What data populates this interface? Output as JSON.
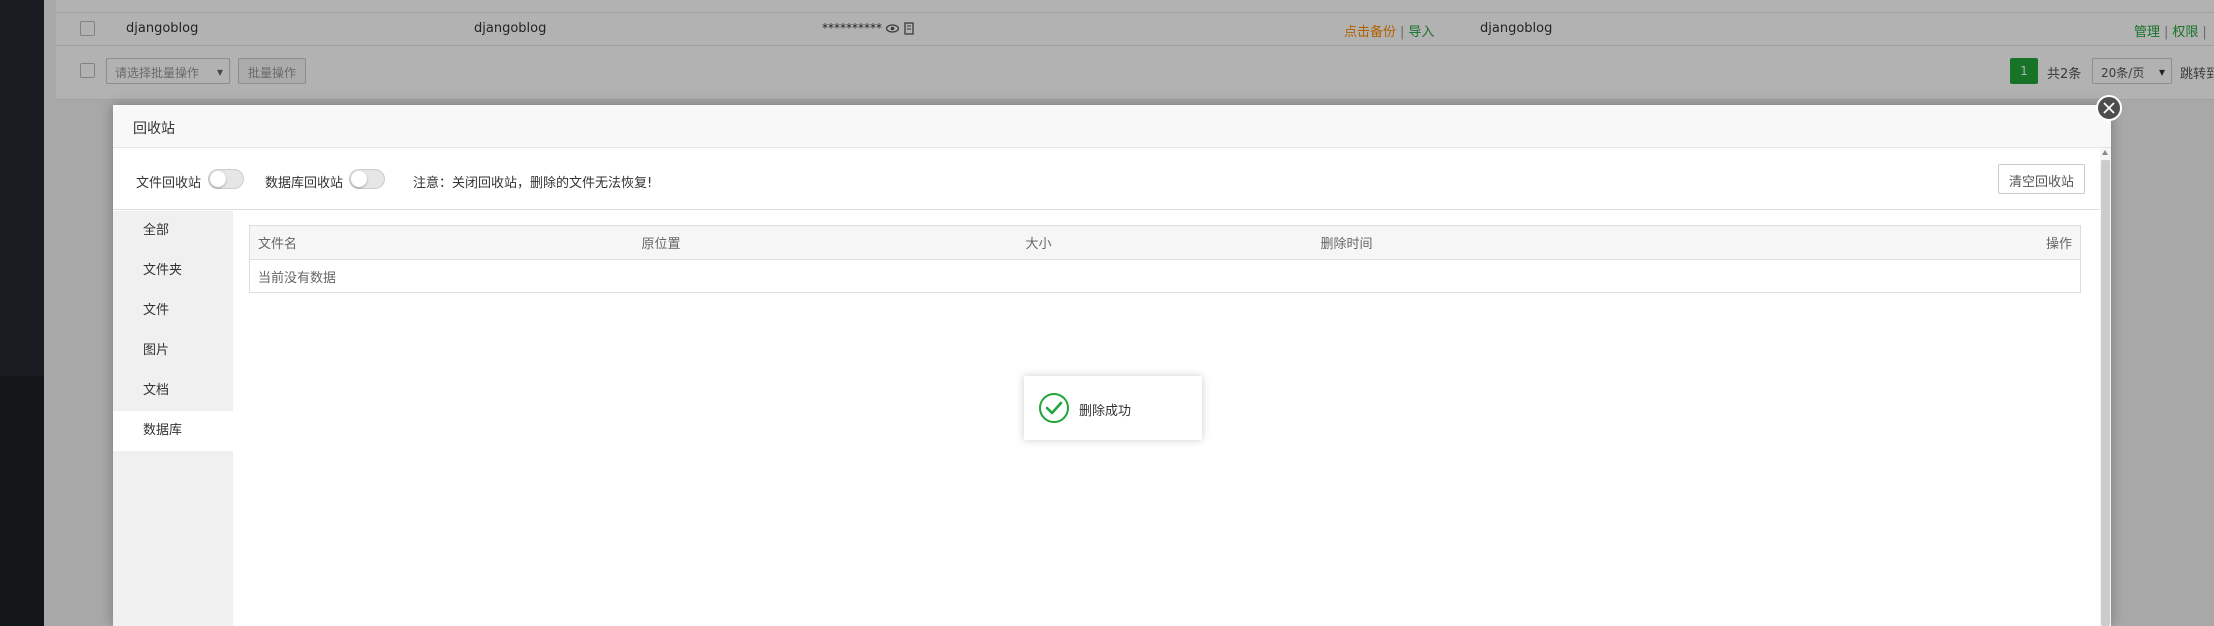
{
  "background_table": {
    "row": {
      "name": "djangoblog",
      "username": "djangoblog",
      "password_mask": "**********",
      "backup_link": "点击备份",
      "import_link": "导入",
      "remark": "djangoblog",
      "manage_link": "管理",
      "permission_link": "权限"
    },
    "bulk_select_placeholder": "请选择批量操作",
    "bulk_button": "批量操作",
    "pager": {
      "current_page": "1",
      "total": "共2条",
      "per_page": "20条/页",
      "jump": "跳转到"
    }
  },
  "modal": {
    "title": "回收站",
    "toolbar": {
      "file_recycle_label": "文件回收站",
      "db_recycle_label": "数据库回收站",
      "notice": "注意：关闭回收站，删除的文件无法恢复!",
      "empty_button": "清空回收站"
    },
    "nav": [
      {
        "label": "全部"
      },
      {
        "label": "文件夹"
      },
      {
        "label": "文件"
      },
      {
        "label": "图片"
      },
      {
        "label": "文档"
      },
      {
        "label": "数据库"
      }
    ],
    "table": {
      "headers": [
        "文件名",
        "原位置",
        "大小",
        "删除时间",
        "操作"
      ],
      "empty_text": "当前没有数据"
    }
  },
  "toast": {
    "message": "删除成功"
  },
  "colors": {
    "accent": "#20a53a",
    "warning": "#ff8c00",
    "toast_icon": "#20a53a"
  }
}
